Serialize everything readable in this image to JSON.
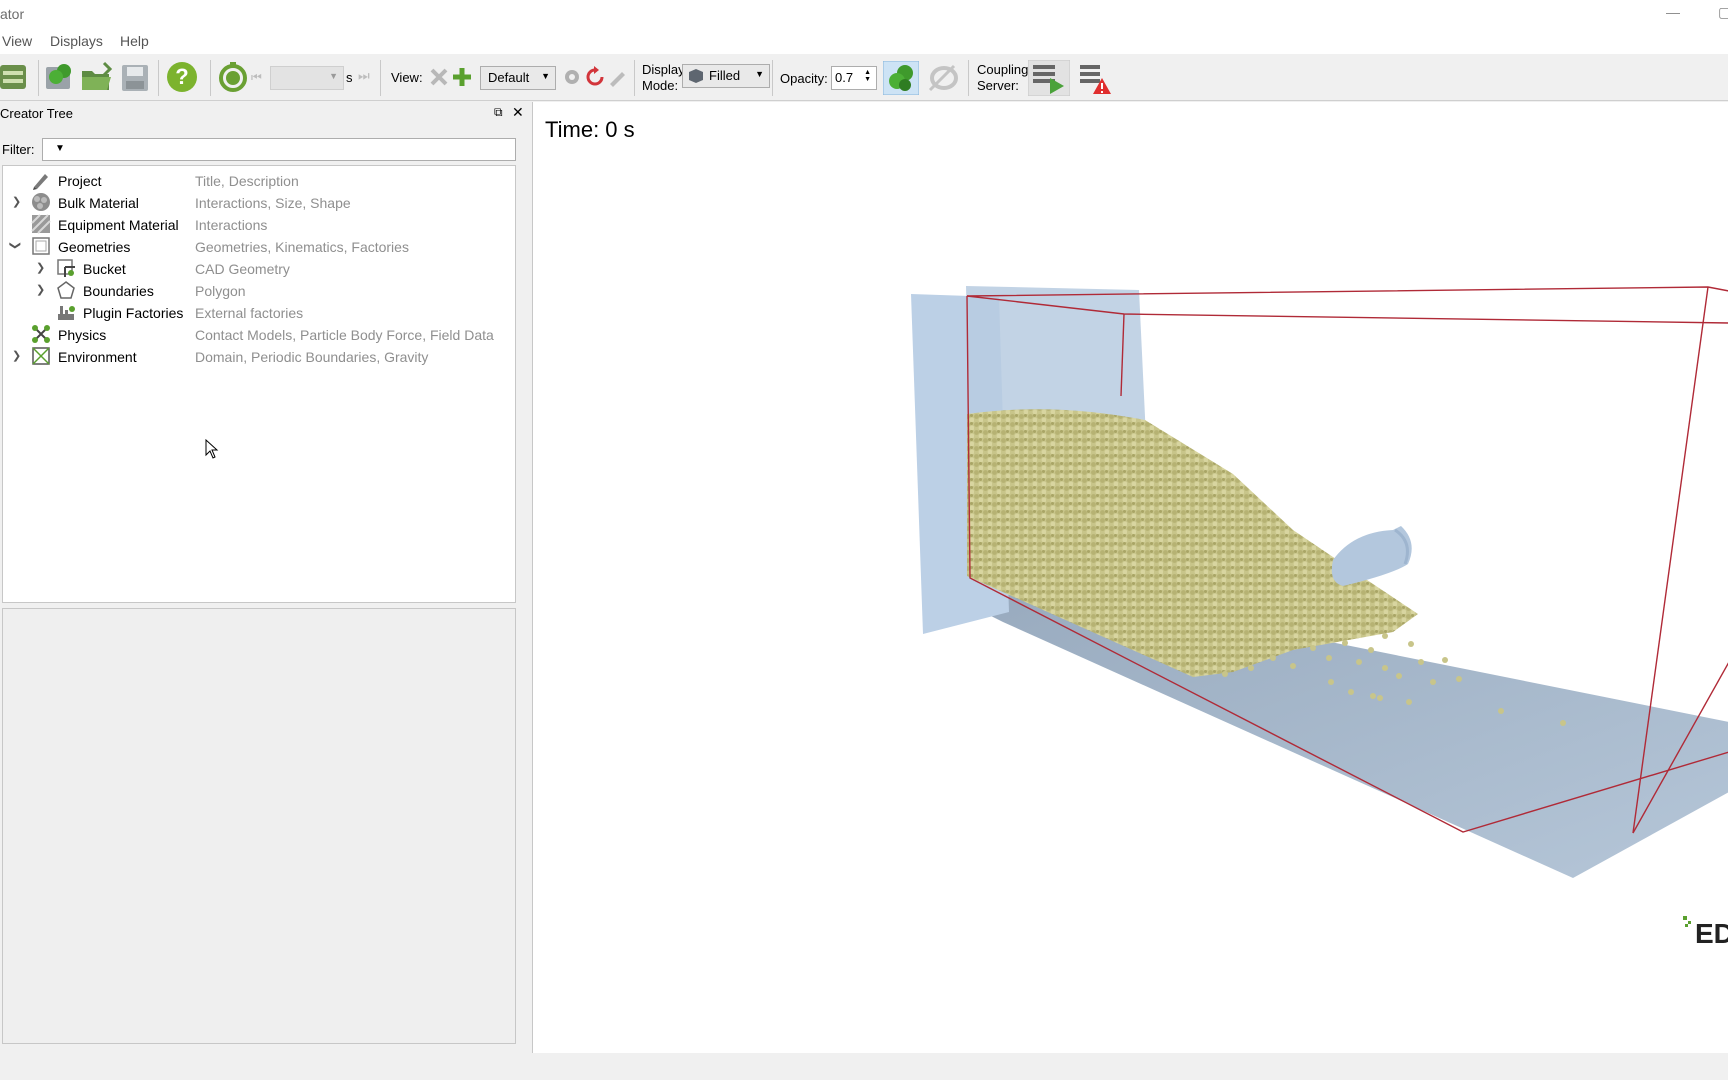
{
  "window": {
    "title": "ator"
  },
  "menu": {
    "view": "View",
    "displays": "Displays",
    "help": "Help"
  },
  "toolbar": {
    "time_unit": "s",
    "view_label": "View:",
    "view_preset": "Default",
    "display_mode_label_1": "Display",
    "display_mode_label_2": "Mode:",
    "display_mode_value": "Filled",
    "opacity_label": "Opacity:",
    "opacity_value": "0.7",
    "coupling_label_1": "Coupling",
    "coupling_label_2": "Server:"
  },
  "panel": {
    "title": "Creator Tree",
    "filter_label": "Filter:"
  },
  "tree": {
    "items": [
      {
        "name": "Project",
        "desc": "Title, Description",
        "icon": "pencil-icon"
      },
      {
        "name": "Bulk Material",
        "desc": "Interactions, Size, Shape",
        "icon": "particles-icon"
      },
      {
        "name": "Equipment Material",
        "desc": "Interactions",
        "icon": "hatched-material-icon"
      },
      {
        "name": "Geometries",
        "desc": "Geometries, Kinematics, Factories",
        "icon": "geometry-box-icon"
      },
      {
        "name": "Bucket",
        "desc": "CAD Geometry",
        "icon": "cad-geometry-icon"
      },
      {
        "name": "Boundaries",
        "desc": "Polygon",
        "icon": "polygon-icon"
      },
      {
        "name": "Plugin Factories",
        "desc": "External factories",
        "icon": "factory-icon"
      },
      {
        "name": "Physics",
        "desc": "Contact Models, Particle Body Force, Field Data",
        "icon": "physics-icon"
      },
      {
        "name": "Environment",
        "desc": "Domain, Periodic Boundaries, Gravity",
        "icon": "environment-icon"
      }
    ]
  },
  "viewport": {
    "time_label": "Time: 0 s",
    "logo_text": "ED"
  },
  "colors": {
    "particles": "#c8c58a",
    "domain_box": "#b02a37",
    "geometry": "#b7c9dd",
    "accent_green": "#5a9e2f"
  }
}
